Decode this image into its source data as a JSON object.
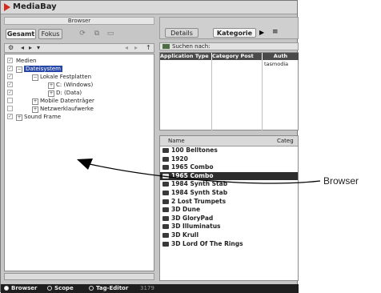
{
  "window": {
    "title": "MediaBay"
  },
  "browser": {
    "header": "Browser",
    "tabs": [
      "Gesamt",
      "Fokus"
    ],
    "tree": [
      {
        "label": "Medien",
        "checked": true,
        "expander": "",
        "sel": false
      },
      {
        "label": "Dateisystem",
        "checked": true,
        "expander": "⊟",
        "sel": true
      },
      {
        "label": "Lokale Festplatten",
        "checked": true,
        "expander": "⊟",
        "sel": false
      },
      {
        "label": "C: (Windows)",
        "checked": true,
        "expander": "⊞",
        "sel": false
      },
      {
        "label": "D: (Data)",
        "checked": true,
        "expander": "⊞",
        "sel": false
      },
      {
        "label": "Mobile Datenträger",
        "checked": false,
        "expander": "⊞",
        "sel": false
      },
      {
        "label": "Netzwerklaufwerke",
        "checked": false,
        "expander": "⊞",
        "sel": false
      },
      {
        "label": "Sound Frame",
        "checked": true,
        "expander": "⊞",
        "sel": false
      }
    ]
  },
  "right": {
    "tabs": [
      "Details",
      "Kategorie"
    ],
    "search_label": "Suchen nach:",
    "attr_columns": [
      "Application Type",
      "Category Post",
      "Auth"
    ],
    "attr_author": "tasmodia",
    "list_columns": [
      "Name",
      "Categ"
    ],
    "items": [
      "100 Belltones",
      "1920",
      "1965 Combo",
      "1965 Combo",
      "1984 Synth Stab",
      "1984 Synth Stab",
      "2 Lost Trumpets",
      "3D Dune",
      "3D GloryPad",
      "3D Illuminatus",
      "3D Krull",
      "3D Lord Of The Rings"
    ],
    "selected_index": 3
  },
  "statusbar": {
    "items": [
      "Browser",
      "Scope",
      "Tag-Editor"
    ],
    "active": "Browser",
    "count": "3179"
  },
  "callout": {
    "label": "Browser"
  },
  "colors": {
    "selection": "#2747a8",
    "accent": "#d62a1c"
  }
}
